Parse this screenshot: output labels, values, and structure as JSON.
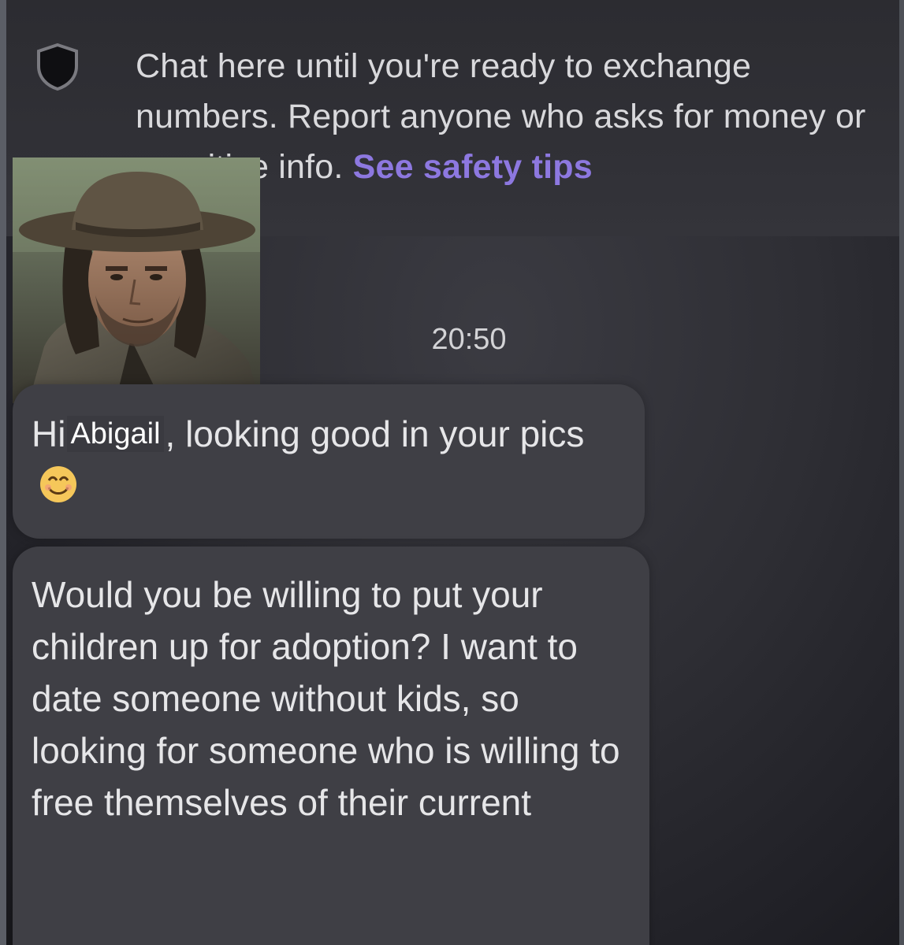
{
  "safety": {
    "icon": "shield-icon",
    "text": "Chat here until you're ready to exchange numbers. Report anyone who asks for money or sensitive info. ",
    "link": "See safety tips",
    "link_color": "#8d78e0"
  },
  "avatar": {
    "icon": "profile-photo"
  },
  "conversation": {
    "timestamp": "20:50",
    "messages": [
      {
        "greeting": "Hi",
        "name": "Abigail",
        "text": ", looking good in your pics",
        "emoji": "smiling-face-icon"
      },
      {
        "text": "Would you be willing to put your children up for adoption? I want to date someone without kids, so looking for someone who is willing to free themselves of their current"
      }
    ]
  },
  "colors": {
    "background": "#2e2e34",
    "bubble": "#3f3f45",
    "text": "#e6e6e8"
  }
}
